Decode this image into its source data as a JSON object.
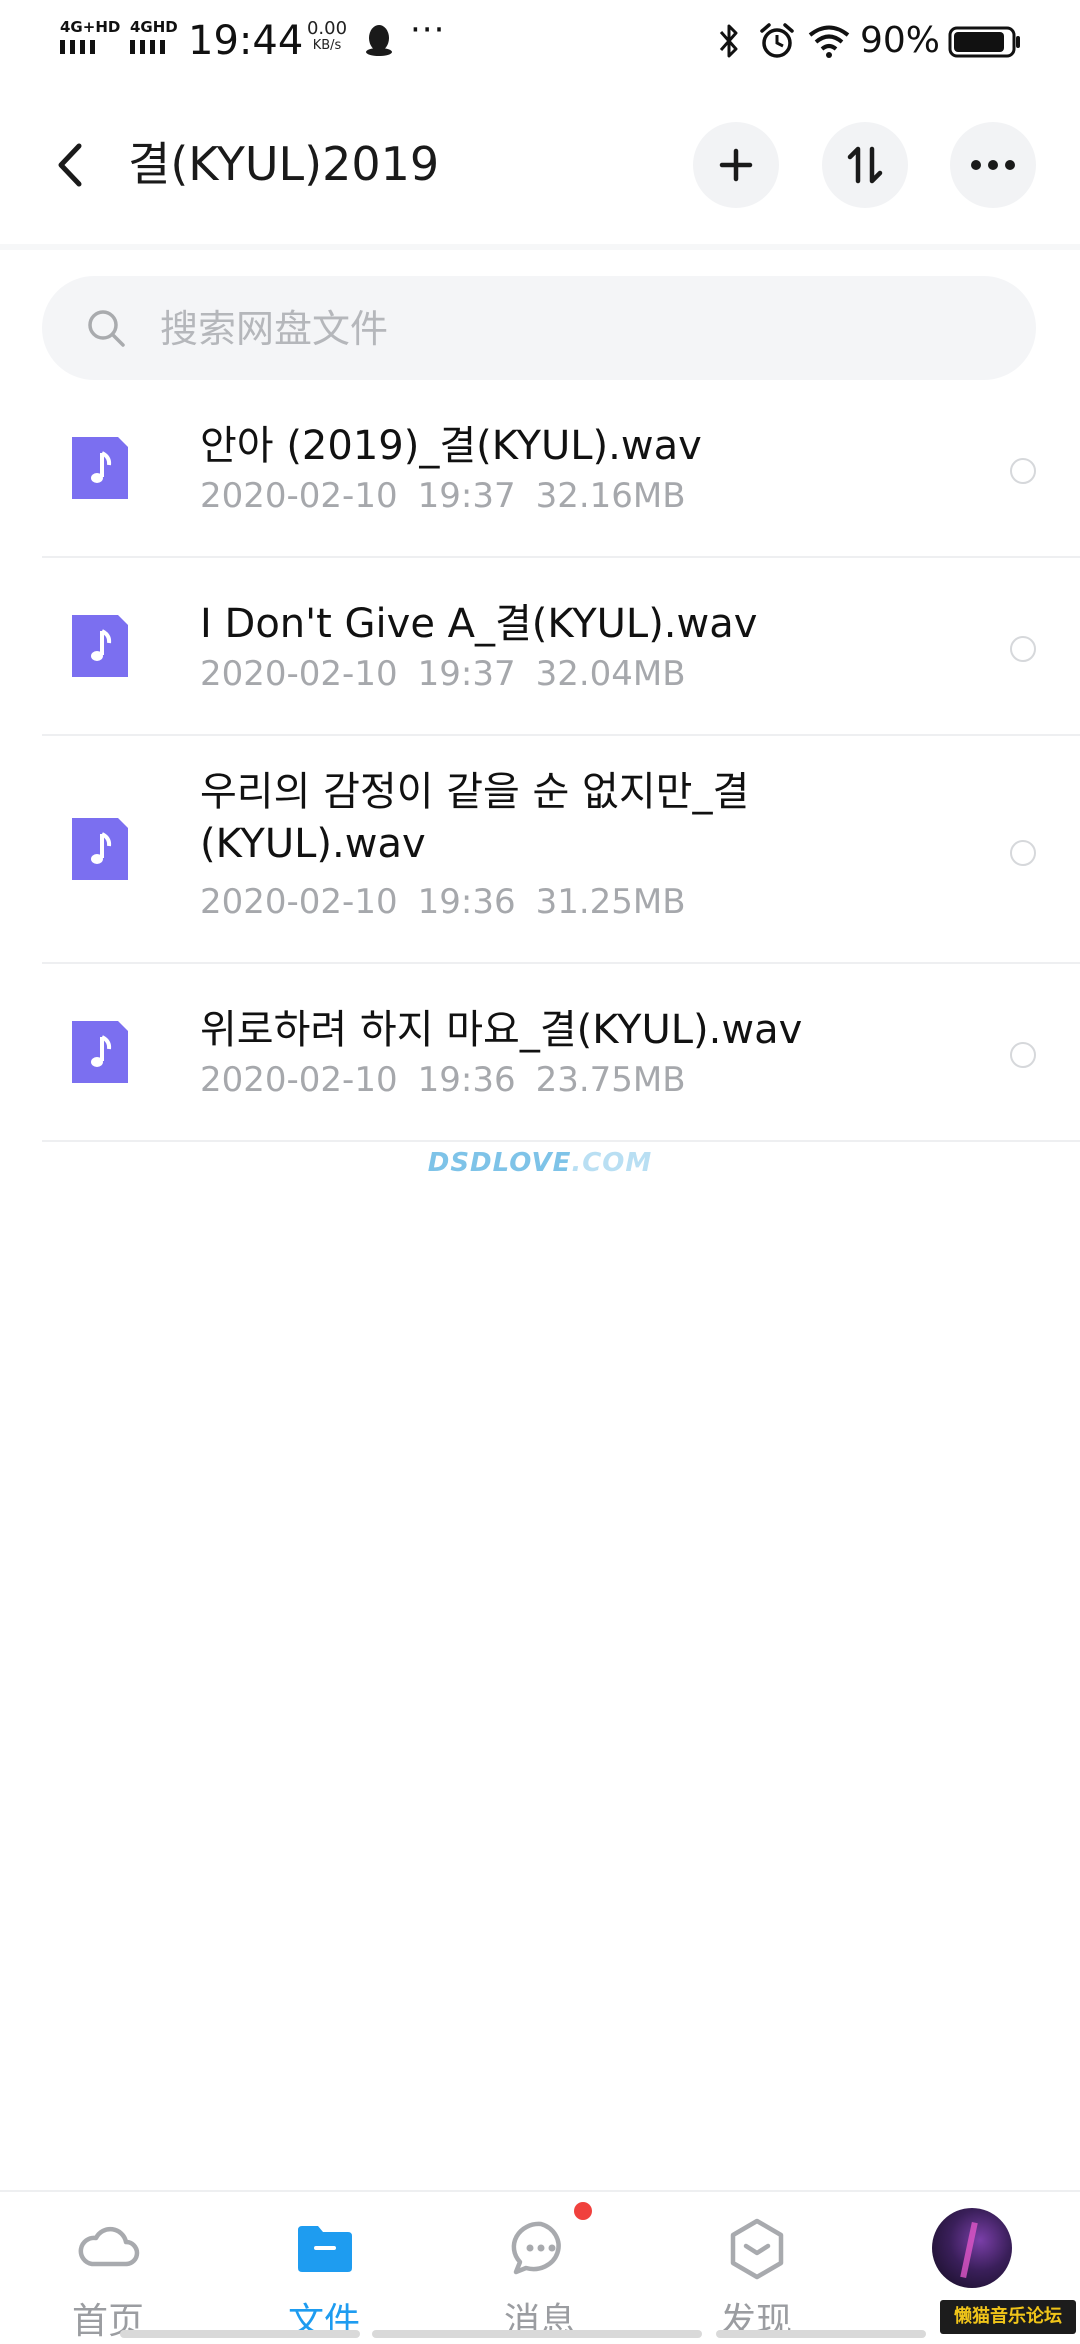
{
  "status_bar": {
    "signal1_label": "4G+HD",
    "signal2_label": "4GHD",
    "time": "19:44",
    "net_speed_value": "0.00",
    "net_speed_unit": "KB/s",
    "more_indicator": "···",
    "battery_percent": "90%",
    "battery_level": 0.9
  },
  "header": {
    "title": "결(KYUL)2019",
    "icons": [
      "back-icon",
      "plus-icon",
      "sort-icon",
      "more-icon"
    ]
  },
  "search": {
    "placeholder": "搜索网盘文件",
    "value": ""
  },
  "files": [
    {
      "name": "안아 (2019)_결(KYUL).wav",
      "date": "2020-02-10",
      "time": "19:37",
      "size": "32.16MB"
    },
    {
      "name": "I Don't Give A_결(KYUL).wav",
      "date": "2020-02-10",
      "time": "19:37",
      "size": "32.04MB"
    },
    {
      "name": "우리의 감정이 같을 순 없지만_결(KYUL).wav",
      "date": "2020-02-10",
      "time": "19:36",
      "size": "31.25MB"
    },
    {
      "name": "위로하려 하지 마요_결(KYUL).wav",
      "date": "2020-02-10",
      "time": "19:36",
      "size": "23.75MB"
    }
  ],
  "watermark": {
    "main": "DSDLOVE",
    "suffix": ".COM"
  },
  "bottom_nav": {
    "items": [
      {
        "label": "首页",
        "icon": "cloud-icon",
        "active": false
      },
      {
        "label": "文件",
        "icon": "folder-icon",
        "active": true
      },
      {
        "label": "消息",
        "icon": "message-icon",
        "active": false,
        "badge": true
      },
      {
        "label": "发现",
        "icon": "discover-icon",
        "active": false
      }
    ]
  },
  "forum_badge": "懒猫音乐论坛",
  "colors": {
    "accent": "#1e9cf0",
    "file_icon": "#7b6ff0",
    "badge": "#f0413d",
    "meta_text": "#a6a8ac"
  }
}
